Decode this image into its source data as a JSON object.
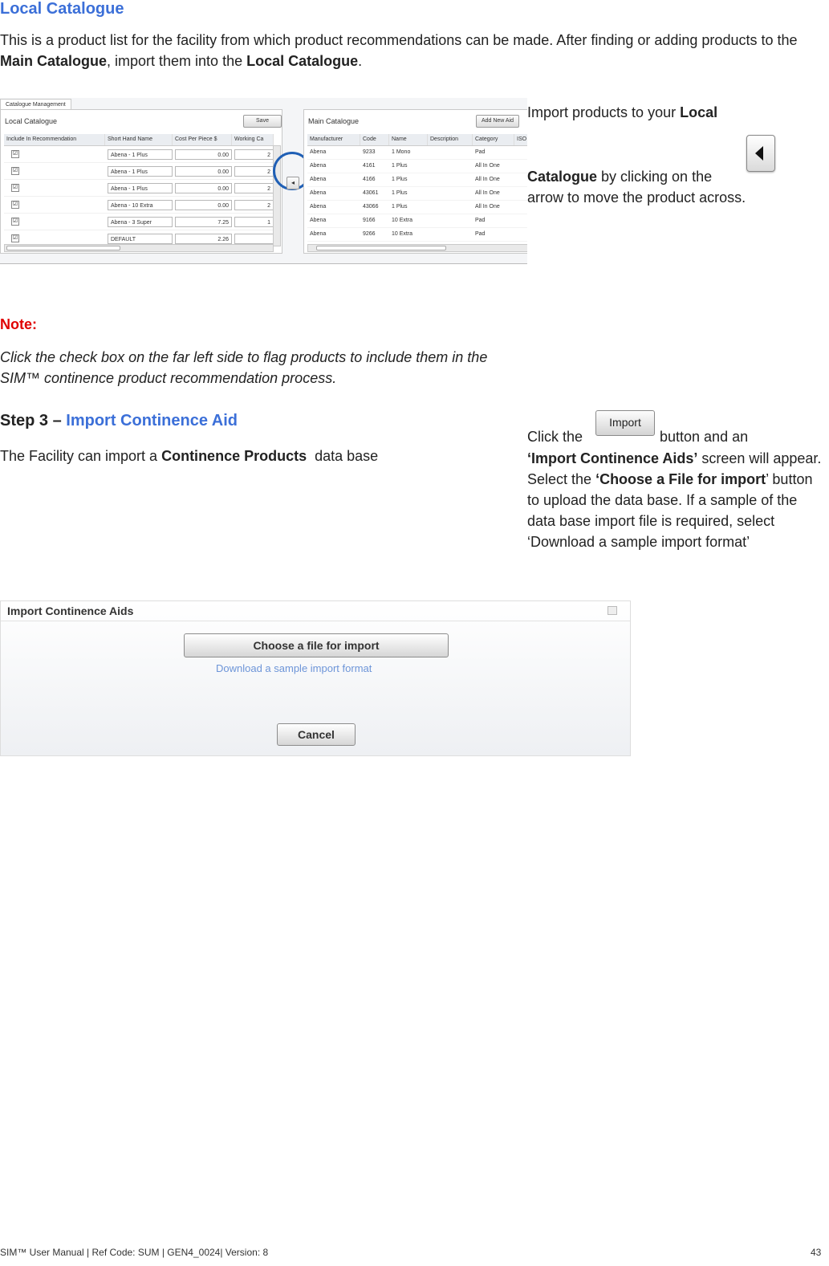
{
  "section": {
    "title": "Local Catalogue",
    "intro_1": "This is a product list for the facility from which product recommendations can be made. After finding or adding products to the ",
    "intro_b1": "Main Catalogue",
    "intro_2": ", import them into the ",
    "intro_b2": "Local Catalogue",
    "intro_3": "."
  },
  "catalogue_screenshot": {
    "tab_label": "Catalogue Management",
    "local_title": "Local Catalogue",
    "save_label": "Save",
    "local_headers": [
      "Include In Recommendation",
      "Short Hand Name",
      "Cost Per Piece $",
      "Working Ca"
    ],
    "local_rows": [
      {
        "check": "☑",
        "name": "Abena - 1 Plus",
        "cost": "0.00",
        "working": "2"
      },
      {
        "check": "☑",
        "name": "Abena - 1 Plus",
        "cost": "0.00",
        "working": "2"
      },
      {
        "check": "☑",
        "name": "Abena - 1 Plus",
        "cost": "0.00",
        "working": "2"
      },
      {
        "check": "☑",
        "name": "Abena - 10 Extra",
        "cost": "0.00",
        "working": "2"
      },
      {
        "check": "☑",
        "name": "Abena - 3 Super",
        "cost": "7.25",
        "working": "1"
      },
      {
        "check": "☑",
        "name": "DEFAULT",
        "cost": "2.26",
        "working": ""
      }
    ],
    "main_title": "Main Catalogue",
    "add_new_label": "Add New Aid",
    "main_headers": [
      "Manufacturer",
      "Code",
      "Name",
      "Description",
      "Category",
      "ISO"
    ],
    "main_rows": [
      {
        "manufacturer": "Abena",
        "code": "9233",
        "name": "1 Mono",
        "description": "",
        "category": "Pad"
      },
      {
        "manufacturer": "Abena",
        "code": "4161",
        "name": "1 Plus",
        "description": "",
        "category": "All In One"
      },
      {
        "manufacturer": "Abena",
        "code": "4166",
        "name": "1 Plus",
        "description": "",
        "category": "All In One"
      },
      {
        "manufacturer": "Abena",
        "code": "43061",
        "name": "1 Plus",
        "description": "",
        "category": "All In One"
      },
      {
        "manufacturer": "Abena",
        "code": "43066",
        "name": "1 Plus",
        "description": "",
        "category": "All In One"
      },
      {
        "manufacturer": "Abena",
        "code": "9166",
        "name": "10 Extra",
        "description": "",
        "category": "Pad"
      },
      {
        "manufacturer": "Abena",
        "code": "9266",
        "name": "10 Extra",
        "description": "",
        "category": "Pad"
      }
    ],
    "highlight_color": "#1f5fb5"
  },
  "right_text": {
    "line1_a": "Import products to your ",
    "line1_b": "Local",
    "line2_b": "Catalogue",
    "line2_a": " by clicking on the",
    "line3": "arrow to move the product across."
  },
  "note": {
    "label": "Note:",
    "text": "Click the check box on the far left side to flag products to include them in the SIM™ continence product recommendation process.",
    "label_color": "#e00000"
  },
  "step3": {
    "prefix": "Step 3 – ",
    "title": "Import Continence Aid",
    "text_a": "The Facility can import a ",
    "text_b": "Continence Products",
    "text_c": "  data base"
  },
  "click_text": {
    "a": "Click the ",
    "import_label": "Import",
    "b": " button and an",
    "c_b": "‘Import Continence Aids’",
    "c": " screen will appear. Select the ",
    "d_b": "‘Choose a File for import",
    "d": "’ button to upload the data base. If a sample of the data base import file is required, select ‘Download a sample import format’"
  },
  "dialog": {
    "title": "Import Continence Aids",
    "choose_label": "Choose a file for import",
    "download_label": "Download a sample import format",
    "cancel_label": "Cancel"
  },
  "footer": {
    "left": "SIM™ User Manual | Ref Code: SUM | GEN4_0024| Version: 8",
    "page": "43"
  }
}
